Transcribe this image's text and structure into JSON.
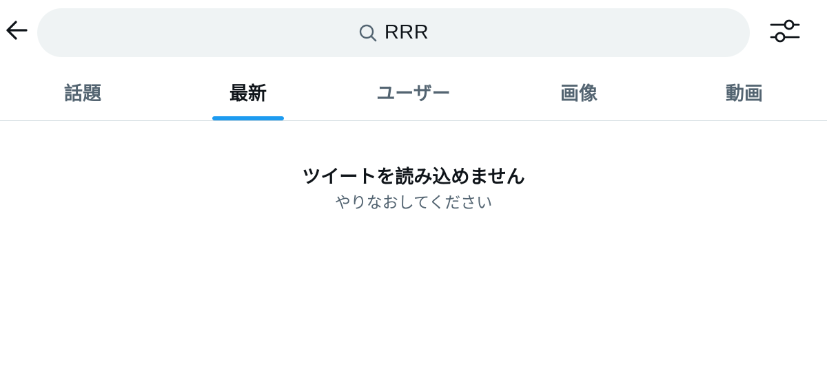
{
  "header": {
    "back_icon": "arrow-left-icon",
    "search": {
      "icon": "search-icon",
      "query": "RRR"
    },
    "filter_icon": "sliders-icon"
  },
  "tabs": [
    {
      "label": "話題",
      "active": false
    },
    {
      "label": "最新",
      "active": true
    },
    {
      "label": "ユーザー",
      "active": false
    },
    {
      "label": "画像",
      "active": false
    },
    {
      "label": "動画",
      "active": false
    }
  ],
  "message": {
    "title": "ツイートを読み込めません",
    "subtitle": "やりなおしてください"
  },
  "colors": {
    "accent": "#1d9bf0",
    "search_bg": "#eff3f4",
    "text_primary": "#0f1419",
    "text_secondary": "#536471",
    "divider": "#cfd9de"
  }
}
